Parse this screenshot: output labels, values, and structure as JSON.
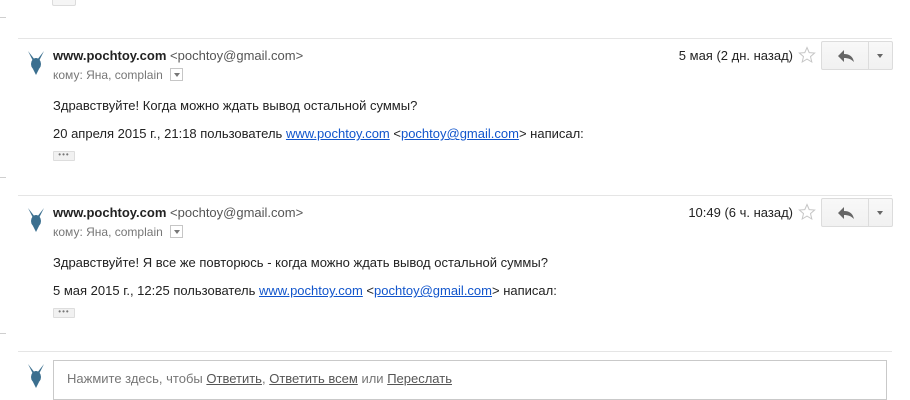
{
  "messages": [
    {
      "sender_name": "www.pochtoy.com",
      "sender_email": "<pochtoy@gmail.com>",
      "to_prefix": "кому:",
      "to_recipients": "Яна, complain",
      "date": "5 мая (2 дн. назад)",
      "body": "Здравствуйте! Когда можно ждать вывод остальной суммы?",
      "quote_date": "20 апреля 2015 г., 21:18 пользователь",
      "quote_site": "www.pochtoy.com",
      "quote_email": "pochtoy@gmail.com",
      "quote_suffix": "написал:"
    },
    {
      "sender_name": "www.pochtoy.com",
      "sender_email": "<pochtoy@gmail.com>",
      "to_prefix": "кому:",
      "to_recipients": "Яна, complain",
      "date": "10:49 (6 ч. назад)",
      "body": "Здравствуйте! Я все же повторюсь - когда можно ждать вывод остальной суммы?",
      "quote_date": "5 мая 2015 г., 12:25 пользователь",
      "quote_site": "www.pochtoy.com",
      "quote_email": "pochtoy@gmail.com",
      "quote_suffix": "написал:"
    }
  ],
  "dots_label": "•••",
  "reply_box": {
    "prefix": "Нажмите здесь, чтобы",
    "reply": "Ответить",
    "separator": ",",
    "reply_all": "Ответить всем",
    "or": "или",
    "forward": "Переслать"
  },
  "icons": {
    "avatar": "bird-logo-icon",
    "star": "star-icon",
    "reply": "reply-arrow-icon",
    "more": "chevron-down-icon"
  },
  "colors": {
    "link": "#1155cc",
    "avatar": "#3b6f8f"
  }
}
